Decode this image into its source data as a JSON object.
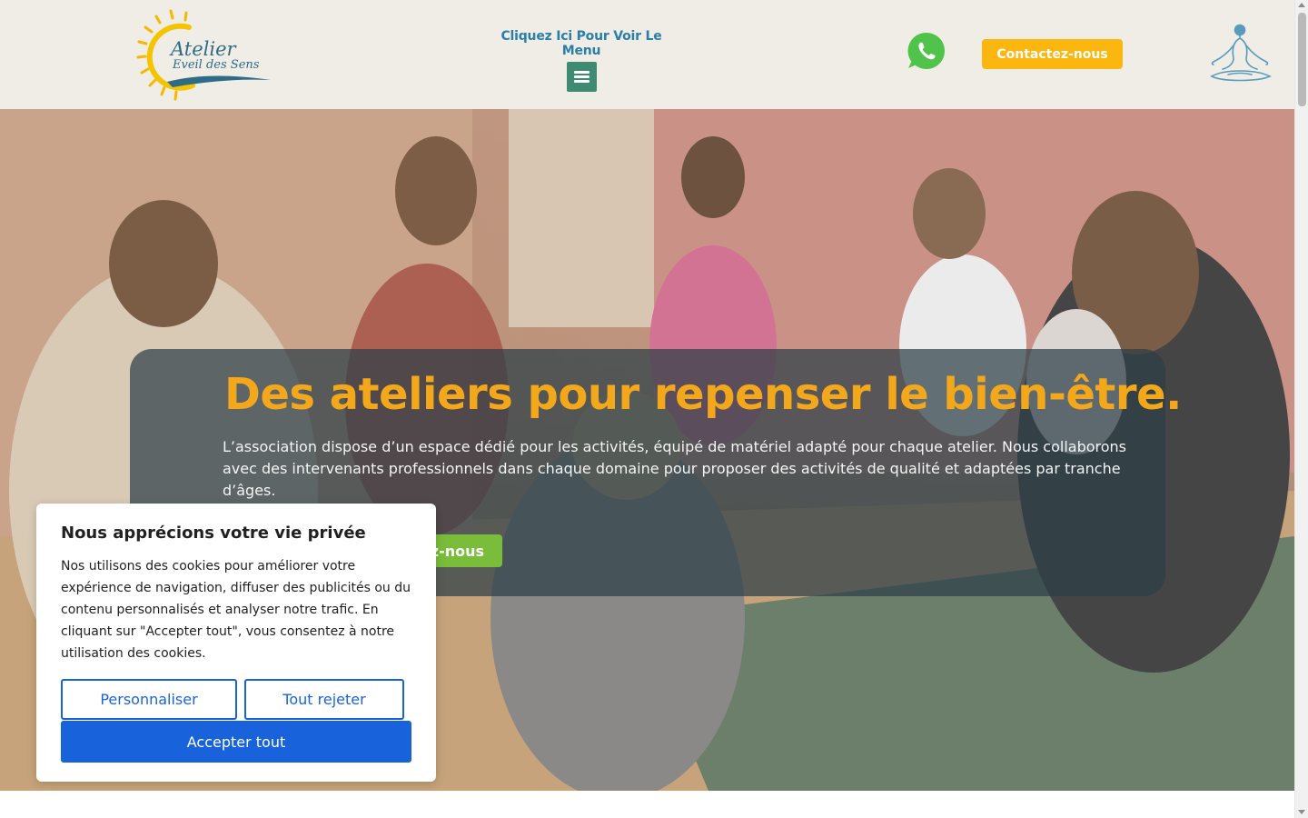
{
  "header": {
    "logo": {
      "line1": "Atelier",
      "line2": "Eveil des Sens"
    },
    "menu_caption": "Cliquez Ici Pour Voir Le Menu",
    "menu_icon": "hamburger-menu-icon",
    "whatsapp_icon": "whatsapp-icon",
    "contact_button": "Contactez-nous",
    "yoga_icon": "meditation-pose-icon"
  },
  "hero": {
    "title": "Des ateliers pour repenser le bien-être.",
    "text": "L’association dispose d’un espace dédié pour les activités, équipé de matériel adapté pour chaque atelier. Nous collaborons avec des intervenants professionnels dans chaque domaine pour proposer des activités de qualité et adaptées par tranche d’âges.",
    "button_visible_text": "z-nous"
  },
  "cookie": {
    "title": "Nous apprécions votre vie privée",
    "text": "Nos utilisons des cookies pour améliorer votre expérience de navigation, diffuser des publicités ou du contenu personnalisés et analyser notre trafic. En cliquant sur \"Accepter tout\", vous consentez à notre utilisation des cookies.",
    "customize": "Personnaliser",
    "reject": "Tout rejeter",
    "accept": "Accepter tout"
  },
  "colors": {
    "header_bg": "#efede6",
    "brand_teal": "#2a7fa7",
    "menu_green": "#3f8a73",
    "contact_yellow": "#fbb610",
    "hero_title_orange": "#f3a81c",
    "hero_button_green": "#79bd3b",
    "cookie_blue": "#1863dc",
    "whatsapp_green": "#4fc34a"
  }
}
